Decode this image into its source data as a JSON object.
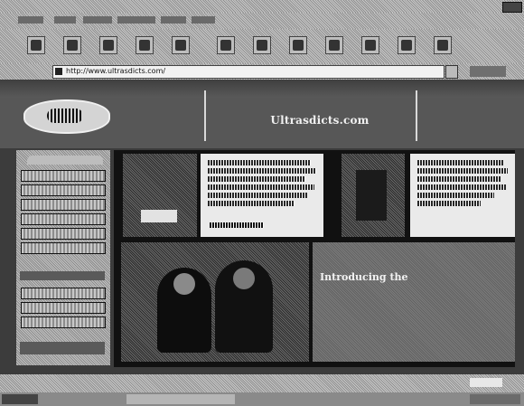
{
  "window": {
    "title": ""
  },
  "menu": {
    "items": [
      "",
      "",
      "",
      "",
      "",
      ""
    ]
  },
  "address": {
    "label": "",
    "url": "http://www.ultrasdicts.com/"
  },
  "site": {
    "logo_text": "",
    "title": "Ultrasdicts.com",
    "article_left_text": "",
    "article_left_more": "",
    "article_right_text": "",
    "headline": "Introducing the",
    "featured_caption": ""
  },
  "status": {
    "left": "",
    "right": ""
  }
}
